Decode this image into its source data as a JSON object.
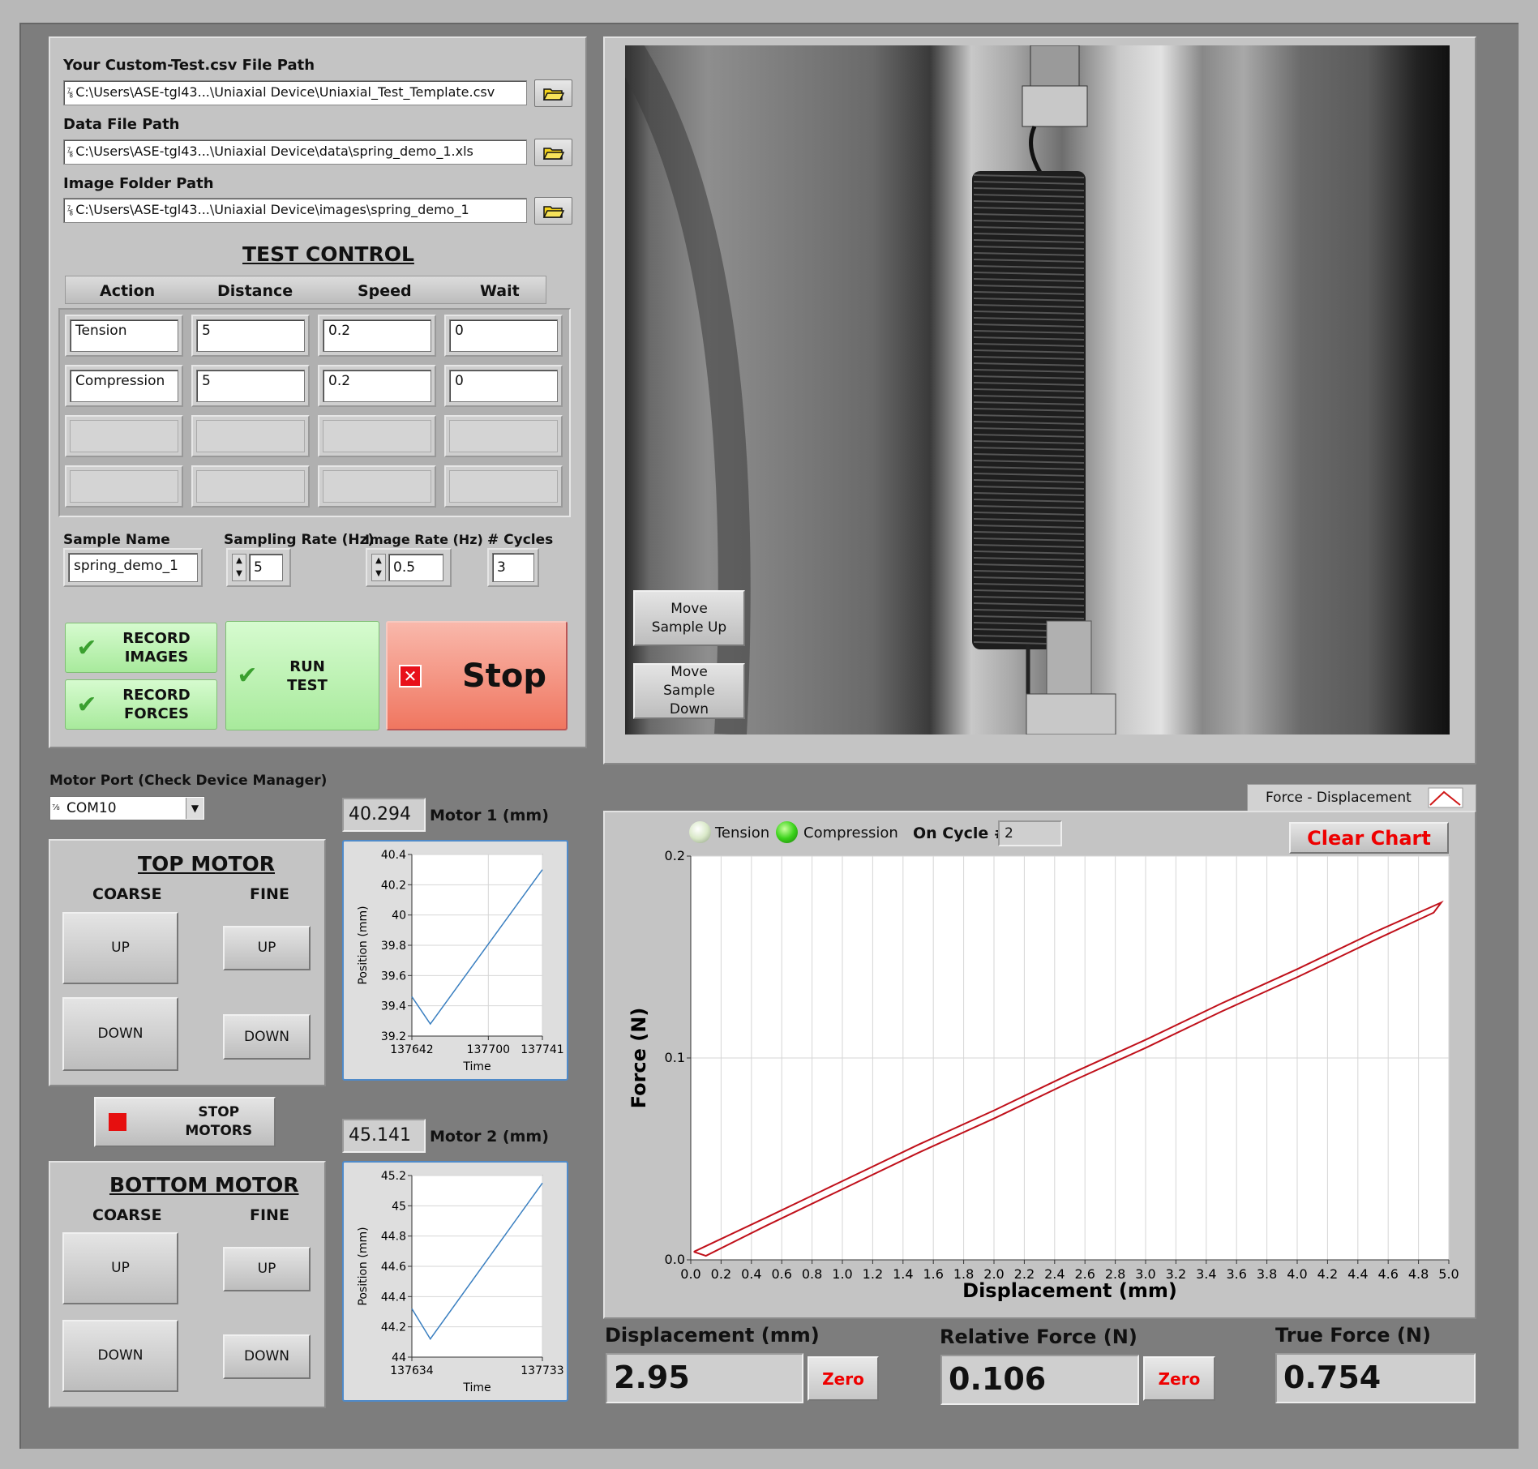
{
  "files": {
    "csv_label": "Your Custom-Test.csv File Path",
    "csv_path": "C:\\Users\\ASE-tgl43...\\Uniaxial Device\\Uniaxial_Test_Template.csv",
    "data_label": "Data File Path",
    "data_path": "C:\\Users\\ASE-tgl43...\\Uniaxial Device\\data\\spring_demo_1.xls",
    "image_label": "Image Folder Path",
    "image_path": "C:\\Users\\ASE-tgl43...\\Uniaxial Device\\images\\spring_demo_1",
    "path_icon": "path-icon",
    "browse_icon": "folder-icon"
  },
  "test_control": {
    "title": "TEST CONTROL",
    "headers": [
      "Action",
      "Distance",
      "Speed",
      "Wait"
    ],
    "rows": [
      [
        "Tension",
        "5",
        "0.2",
        "0"
      ],
      [
        "Compression",
        "5",
        "0.2",
        "0"
      ],
      [
        "",
        "",
        "",
        ""
      ],
      [
        "",
        "",
        "",
        ""
      ]
    ]
  },
  "sample": {
    "name_label": "Sample Name",
    "name_value": "spring_demo_1",
    "sampling_label": "Sampling Rate (Hz)",
    "sampling_value": "5",
    "image_rate_label": "Image Rate (Hz)",
    "image_rate_value": "0.5",
    "cycles_label": "# Cycles",
    "cycles_value": "3"
  },
  "buttons": {
    "record_images": "RECORD IMAGES",
    "record_forces": "RECORD FORCES",
    "run_test": "RUN TEST",
    "stop": "Stop",
    "move_up": "Move Sample Up",
    "move_down": "Move Sample Down",
    "stop_motors": "STOP MOTORS",
    "clear_chart": "Clear Chart",
    "zero": "Zero"
  },
  "motor": {
    "port_label": "Motor Port (Check Device Manager)",
    "port_value": "COM10",
    "top_title": "TOP MOTOR",
    "bottom_title": "BOTTOM MOTOR",
    "coarse": "COARSE",
    "fine": "FINE",
    "up": "UP",
    "down": "DOWN",
    "motor1_value": "40.294",
    "motor1_label": "Motor 1 (mm)",
    "motor2_value": "45.141",
    "motor2_label": "Motor 2 (mm)"
  },
  "main_chart": {
    "legend_label": "Force - Displacement",
    "tension_label": "Tension",
    "compression_label": "Compression",
    "cycle_label": "On Cycle #",
    "cycle_value": "2"
  },
  "readouts": {
    "disp_label": "Displacement (mm)",
    "disp_value": "2.95",
    "rel_label": "Relative Force (N)",
    "rel_value": "0.106",
    "true_label": "True Force (N)",
    "true_value": "0.754"
  },
  "colors": {
    "stop_red": "#f06a55",
    "run_green": "#b9f2ad",
    "plot_red": "#c0101a",
    "plot_blue": "#3a7fc0",
    "led_green": "#3bd31b"
  },
  "chart_data": [
    {
      "type": "line",
      "title": "",
      "xlabel": "Time",
      "ylabel": "Position (mm)",
      "xlim": [
        137642,
        137741
      ],
      "ylim": [
        39.2,
        40.4
      ],
      "x_ticks": [
        "137642",
        "137700",
        "137741"
      ],
      "y_ticks": [
        "40.4",
        "40.2",
        "40",
        "39.8",
        "39.6",
        "39.4",
        "39.2"
      ],
      "series": [
        {
          "x": [
            137642,
            137656,
            137741
          ],
          "y": [
            39.46,
            39.28,
            40.3
          ]
        }
      ]
    },
    {
      "type": "line",
      "title": "",
      "xlabel": "Time",
      "ylabel": "Position (mm)",
      "xlim": [
        137634,
        137733
      ],
      "ylim": [
        44,
        45.2
      ],
      "x_ticks": [
        "137634",
        "137733"
      ],
      "y_ticks": [
        "45.2",
        "45",
        "44.8",
        "44.6",
        "44.4",
        "44.2",
        "44"
      ],
      "series": [
        {
          "x": [
            137634,
            137648,
            137733
          ],
          "y": [
            44.32,
            44.12,
            45.15
          ]
        }
      ]
    },
    {
      "type": "line",
      "title": "",
      "xlabel": "Displacement (mm)",
      "ylabel": "Force (N)",
      "xlim": [
        0,
        5
      ],
      "ylim": [
        0,
        0.2
      ],
      "x_ticks": [
        "0.0",
        "0.2",
        "0.4",
        "0.6",
        "0.8",
        "1.0",
        "1.2",
        "1.4",
        "1.6",
        "1.8",
        "2.0",
        "2.2",
        "2.4",
        "2.6",
        "2.8",
        "3.0",
        "3.2",
        "3.4",
        "3.6",
        "3.8",
        "4.0",
        "4.2",
        "4.4",
        "4.6",
        "4.8",
        "5.0"
      ],
      "y_ticks": [
        "0.2",
        "0.1",
        "0.0"
      ],
      "series": [
        {
          "x": [
            0.02,
            0.5,
            1.0,
            1.5,
            2.0,
            2.5,
            3.0,
            3.5,
            4.0,
            4.5,
            4.95,
            4.9,
            4.5,
            4.0,
            3.5,
            3.0,
            2.5,
            2.0,
            1.5,
            1.0,
            0.5,
            0.1,
            0.02
          ],
          "y": [
            0.004,
            0.021,
            0.039,
            0.057,
            0.074,
            0.092,
            0.109,
            0.127,
            0.144,
            0.162,
            0.177,
            0.172,
            0.158,
            0.14,
            0.123,
            0.105,
            0.088,
            0.07,
            0.053,
            0.035,
            0.017,
            0.002,
            0.004
          ]
        }
      ]
    }
  ]
}
